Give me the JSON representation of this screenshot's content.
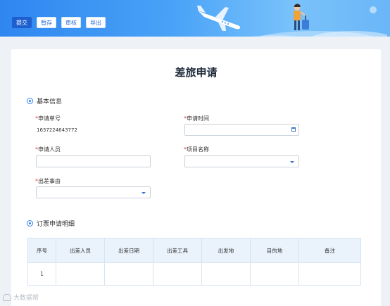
{
  "toolbar": {
    "submit_label": "提交",
    "save_label": "暂存",
    "review_label": "审核",
    "export_label": "导出"
  },
  "page": {
    "title": "差旅申请"
  },
  "basic_info": {
    "section_title": "基本信息",
    "application_no": {
      "label": "申请单号",
      "value": "1637224643772"
    },
    "application_time": {
      "label": "申请时间",
      "value": ""
    },
    "applicant": {
      "label": "申请人员",
      "value": ""
    },
    "project_name": {
      "label": "项目名称",
      "value": ""
    },
    "trip_reason": {
      "label": "出差事由",
      "value": ""
    },
    "required_mark": "*"
  },
  "booking_details": {
    "section_title": "订票申请明细",
    "columns": [
      "序号",
      "出差人员",
      "出差日期",
      "出差工具",
      "出发地",
      "目的地",
      "备注"
    ],
    "rows": [
      [
        "1",
        "",
        "",
        "",
        "",
        "",
        ""
      ]
    ]
  },
  "watermark": {
    "text": "大数据帮"
  },
  "colors": {
    "accent": "#2f7ff0",
    "primary_button": "#1d5fce",
    "required": "#e23a3a",
    "table_header": "#eaf3fc"
  },
  "icons": [
    "airplane-icon",
    "traveler-illustration",
    "calendar-icon",
    "chevron-down-icon",
    "section-dot-icon"
  ]
}
